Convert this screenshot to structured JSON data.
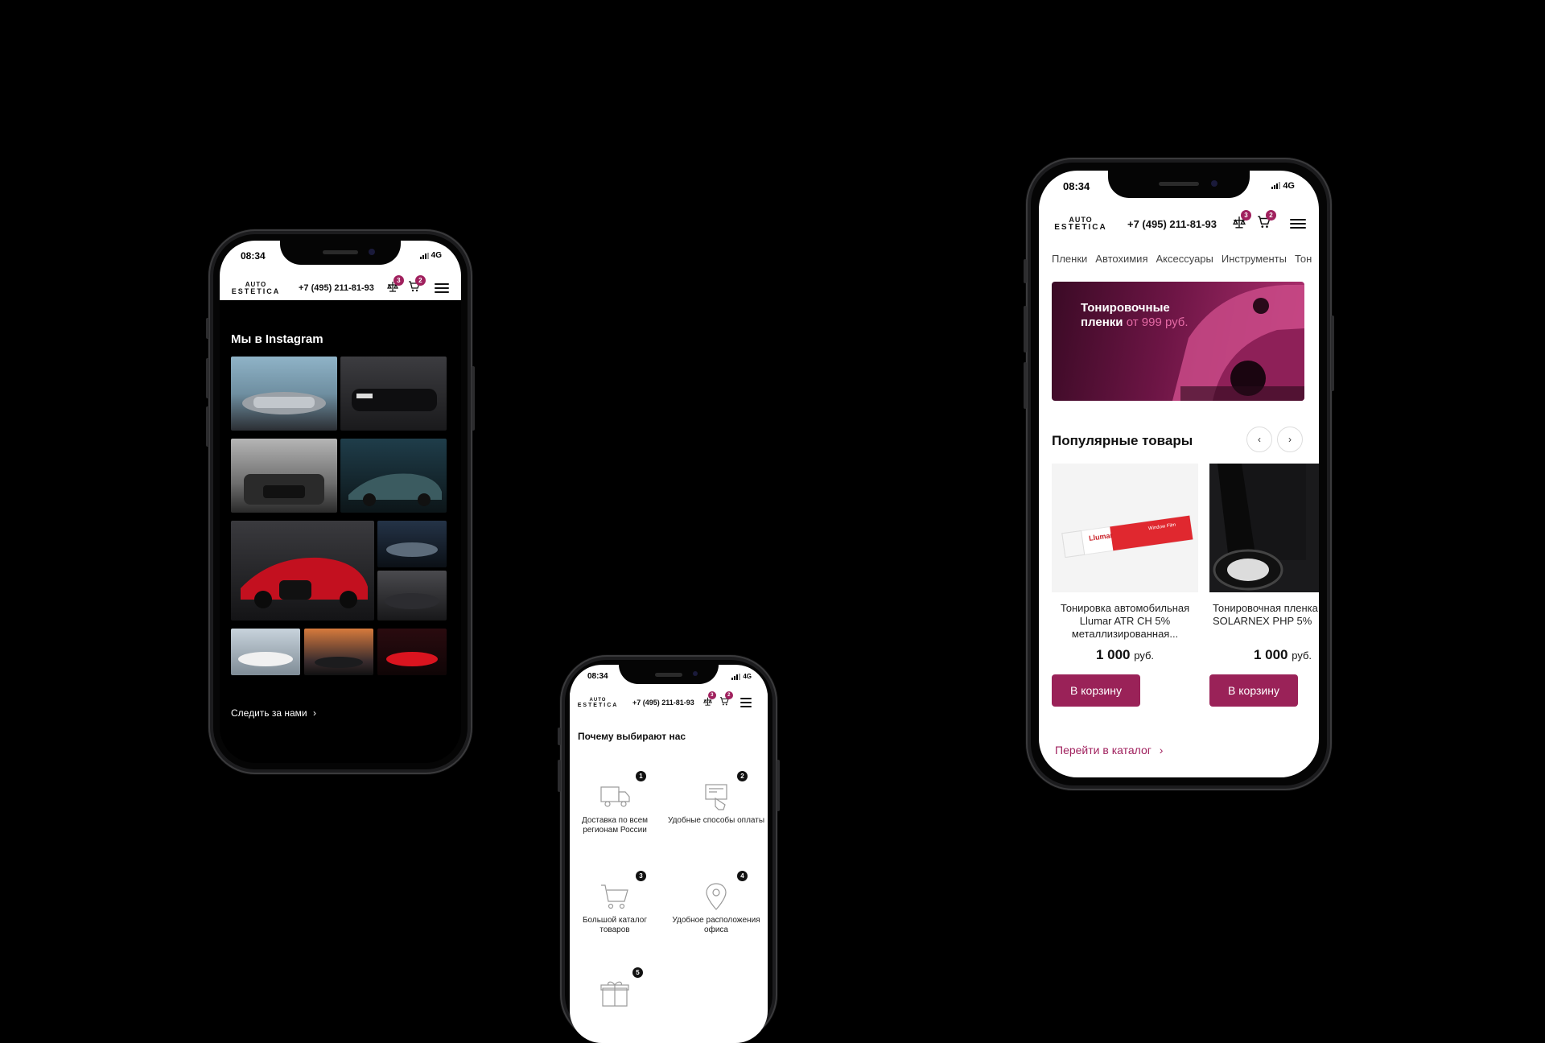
{
  "status": {
    "time": "08:34",
    "network": "4G"
  },
  "header": {
    "logo_top": "AUTO",
    "logo_bottom": "ESTETICA",
    "phone": "+7 (495) 211-81-93",
    "compare_count": "3",
    "cart_count": "2"
  },
  "instagram": {
    "title": "Мы в Instagram",
    "follow_link": "Следить за нами",
    "tile_colors": [
      "#5d7f93",
      "#2a2a2e",
      "#8f8f8f",
      "#22434a",
      "#7a0c19",
      "#1d2a38",
      "#2e2e32",
      "#aab7c2",
      "#c55a2b",
      "#5a0c12"
    ]
  },
  "why_us": {
    "title": "Почему выбирают нас",
    "features": [
      {
        "num": "1",
        "label": "Доставка по всем регионам России",
        "icon": "truck-icon"
      },
      {
        "num": "2",
        "label": "Удобные способы оплаты",
        "icon": "payment-terminal-icon"
      },
      {
        "num": "3",
        "label": "Большой каталог товаров",
        "icon": "shopping-cart-icon"
      },
      {
        "num": "4",
        "label": "Удобное расположения офиса",
        "icon": "map-pin-icon"
      },
      {
        "num": "5",
        "label": "",
        "icon": "gift-icon"
      }
    ]
  },
  "catalog": {
    "nav": [
      "Пленки",
      "Автохимия",
      "Аксессуары",
      "Инструменты",
      "Тон"
    ],
    "banner_line1": "Тонировочные",
    "banner_line2": "пленки",
    "banner_accent": "от 999 руб.",
    "popular_title": "Популярные товары",
    "prev_label": "‹",
    "next_label": "›",
    "products": [
      {
        "name": "Тонировка автомобильная Llumar ATR CH 5% металлизированная...",
        "price": "1 000",
        "currency": "руб.",
        "button": "В корзину",
        "image_label": "Llumar",
        "image_sub": "Window Film"
      },
      {
        "name": "Тонировочная пленка SOLARNEX PHP 5%",
        "price": "1 000",
        "currency": "руб.",
        "button": "В корзину"
      }
    ],
    "goto_catalog": "Перейти в каталог"
  },
  "colors": {
    "accent": "#9a2258",
    "badge": "#a0215e"
  }
}
